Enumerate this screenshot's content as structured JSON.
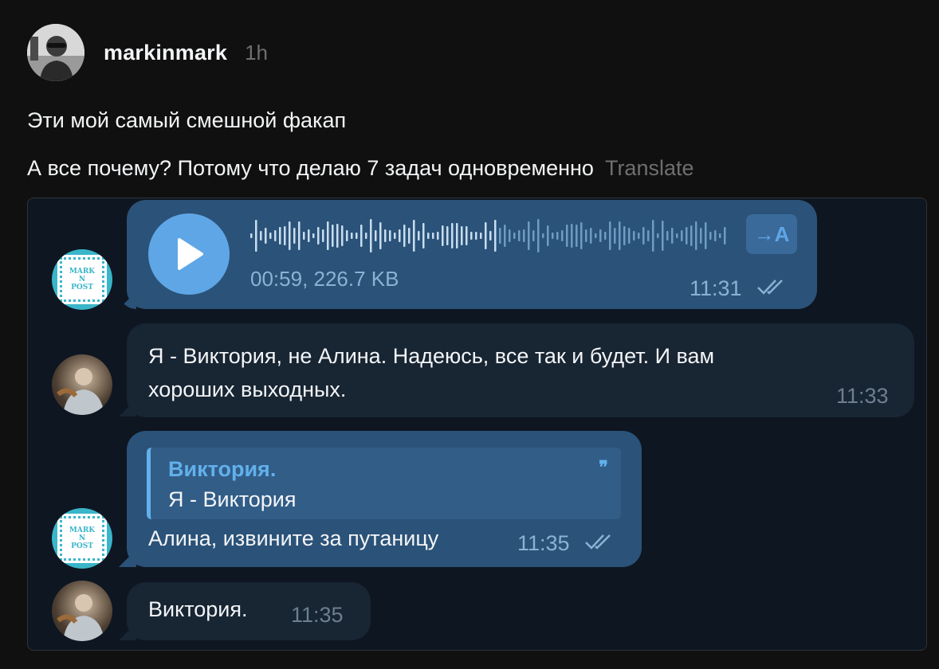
{
  "post": {
    "author": "markinmark",
    "time": "1h",
    "text_line1": "Эти мой самый смешной факап",
    "text_line2": "А все почему? Потому что делаю 7 задач одновременно",
    "translate_label": "Translate"
  },
  "chat": {
    "voice_message": {
      "meta": "00:59, 226.7 KB",
      "time": "11:31",
      "transcribe_icon": "→A",
      "played_fraction": 0.52
    },
    "message_1": {
      "line1": "Я - Виктория, не Алина. Надеюсь, все так и будет. И вам",
      "line2": "хороших выходных.",
      "time": "11:33"
    },
    "message_2": {
      "reply_author": "Виктория.",
      "reply_text": "Я - Виктория",
      "text": "Алина, извините за путаницу",
      "time": "11:35"
    },
    "message_3": {
      "text": "Виктория.",
      "time": "11:35"
    },
    "mark_avatar_lines": [
      "MARK",
      "N",
      "POST"
    ]
  },
  "colors": {
    "background": "#101010",
    "chat_background": "#0e1621",
    "outgoing_bubble": "#2b5278",
    "incoming_bubble": "#182533",
    "accent": "#5fa6e6"
  }
}
